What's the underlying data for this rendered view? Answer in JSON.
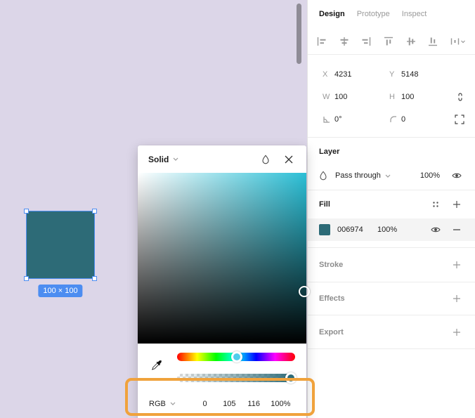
{
  "canvas": {
    "size_badge": "100 × 100",
    "square_color": "#2D6B77",
    "selection_color": "#4C8DF1",
    "background_color": "#DCD6E8"
  },
  "tabs": {
    "design": "Design",
    "prototype": "Prototype",
    "inspect": "Inspect"
  },
  "properties": {
    "x_label": "X",
    "x_value": "4231",
    "y_label": "Y",
    "y_value": "5148",
    "w_label": "W",
    "w_value": "100",
    "h_label": "H",
    "h_value": "100",
    "rotation_value": "0°",
    "radius_value": "0"
  },
  "layer": {
    "title": "Layer",
    "blend_mode": "Pass through",
    "opacity": "100%"
  },
  "fill": {
    "title": "Fill",
    "hex": "006974",
    "opacity": "100%",
    "swatch_color": "#2D6B77"
  },
  "stroke": {
    "title": "Stroke"
  },
  "effects": {
    "title": "Effects"
  },
  "export": {
    "title": "Export"
  },
  "picker": {
    "mode": "Solid",
    "gradient_top_right_color": "#2BBFD6",
    "hue_handle_color": "#4FCDEC",
    "alpha_handle_color": "#2D6B78",
    "rgb": {
      "model": "RGB",
      "r": "0",
      "g": "105",
      "b": "116",
      "a": "100%"
    }
  },
  "annotation": {
    "highlight_color": "#F0A23C"
  }
}
